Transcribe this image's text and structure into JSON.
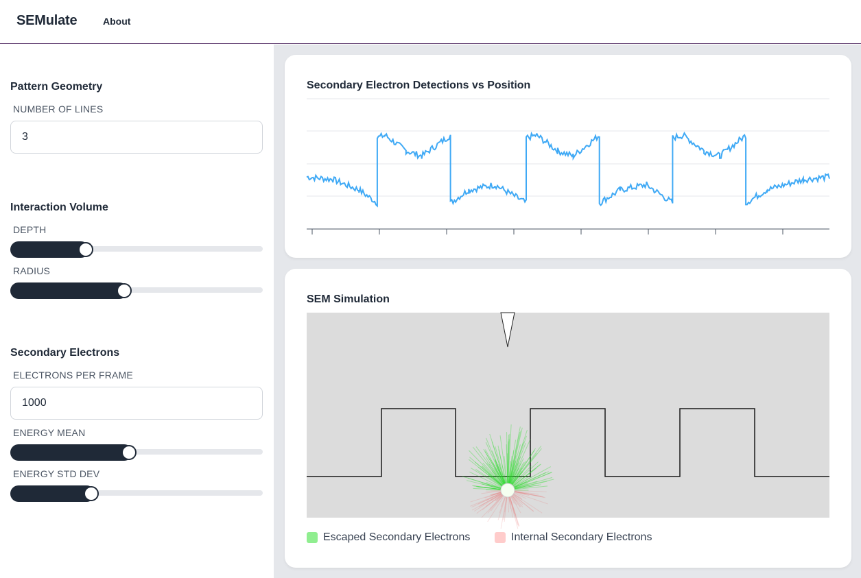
{
  "nav": {
    "brand": "SEMulate",
    "about": "About"
  },
  "sidebar": {
    "pattern_geometry": {
      "title": "Pattern Geometry",
      "lines_label": "NUMBER OF LINES",
      "lines_value": "3"
    },
    "interaction_volume": {
      "title": "Interaction Volume",
      "depth_label": "DEPTH",
      "depth_fraction": 0.3,
      "radius_label": "RADIUS",
      "radius_fraction": 0.45
    },
    "secondary_electrons": {
      "title": "Secondary Electrons",
      "per_frame_label": "ELECTRONS PER FRAME",
      "per_frame_value": "1000",
      "energy_mean_label": "ENERGY MEAN",
      "energy_mean_fraction": 0.47,
      "energy_std_label": "ENERGY STD DEV",
      "energy_std_fraction": 0.32
    }
  },
  "chart_card": {
    "title": "Secondary Electron Detections vs Position"
  },
  "chart_data": {
    "type": "line",
    "title": "Secondary Electron Detections vs Position",
    "xlabel": "",
    "ylabel": "",
    "x_ticks": 8,
    "grid": true,
    "line_color": "#3fa9f5",
    "segments": [
      {
        "x": [
          0,
          5,
          10,
          13.5
        ],
        "y": [
          40,
          38,
          30,
          20
        ]
      },
      {
        "x": [
          13.5,
          15,
          19,
          22,
          27.5
        ],
        "y": [
          70,
          72,
          60,
          56,
          72
        ]
      },
      {
        "x": [
          27.5,
          31,
          36,
          42
        ],
        "y": [
          20,
          30,
          34,
          20
        ]
      },
      {
        "x": [
          42,
          44,
          48,
          51,
          56
        ],
        "y": [
          70,
          72,
          60,
          56,
          72
        ]
      },
      {
        "x": [
          56,
          60,
          65,
          70
        ],
        "y": [
          20,
          30,
          34,
          20
        ]
      },
      {
        "x": [
          70,
          72,
          76,
          79,
          84
        ],
        "y": [
          70,
          72,
          60,
          56,
          72
        ]
      },
      {
        "x": [
          84,
          88,
          95,
          100
        ],
        "y": [
          20,
          30,
          38,
          40
        ]
      }
    ],
    "ylim": [
      0,
      100
    ]
  },
  "sim_card": {
    "title": "SEM Simulation",
    "sample_color": "#dcdcdc",
    "profile_lines": 3
  },
  "legend": {
    "escaped": {
      "label": "Escaped Secondary Electrons",
      "color": "#90ee90"
    },
    "internal": {
      "label": "Internal Secondary Electrons",
      "color": "#ffcccb"
    }
  }
}
